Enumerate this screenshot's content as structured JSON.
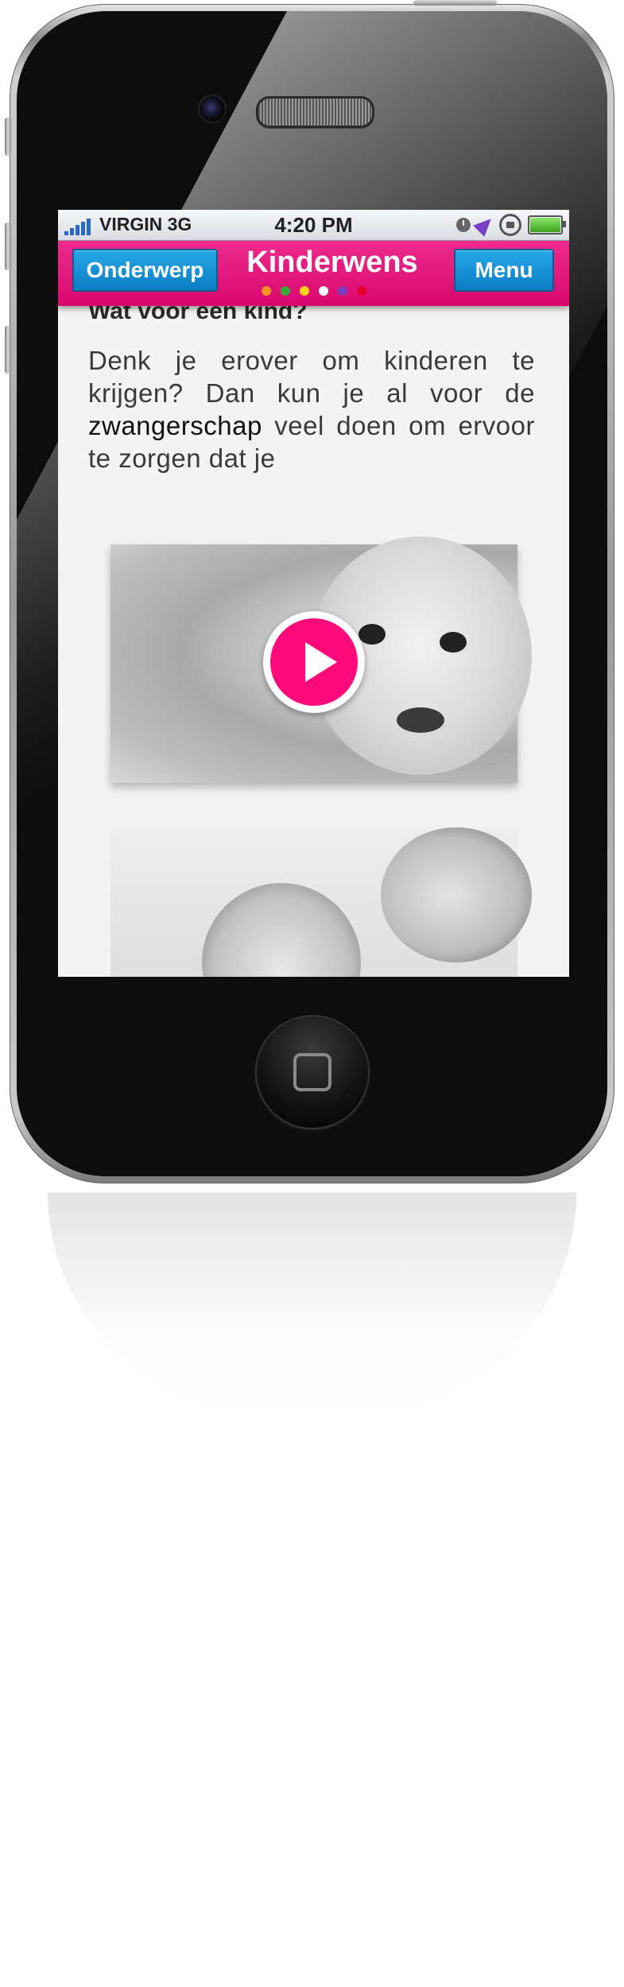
{
  "statusbar": {
    "carrier": "VIRGIN 3G",
    "time": "4:20 PM",
    "icons": [
      "signal-icon",
      "alarm-icon",
      "location-icon",
      "rotation-lock-icon",
      "battery-icon"
    ]
  },
  "navbar": {
    "left_button": "Onderwerp",
    "title": "Kinderwens",
    "right_button": "Menu",
    "dot_colors": [
      "#f7941d",
      "#3aa935",
      "#f7d417",
      "#ffffff",
      "#7b3fc4",
      "#e4002b"
    ],
    "color": "#e0117a",
    "button_color": "#1a93d8"
  },
  "content": {
    "heading": "Wat voor een kind?",
    "paragraph_start": "Denk je erover om kinderen te krijgen? Dan kun je al voor de ",
    "paragraph_bold": "zwangerschap",
    "paragraph_end": " veel doen om ervoor te zorgen dat je",
    "video_play_icon": "play-icon",
    "play_color": "#ff0a7a"
  }
}
